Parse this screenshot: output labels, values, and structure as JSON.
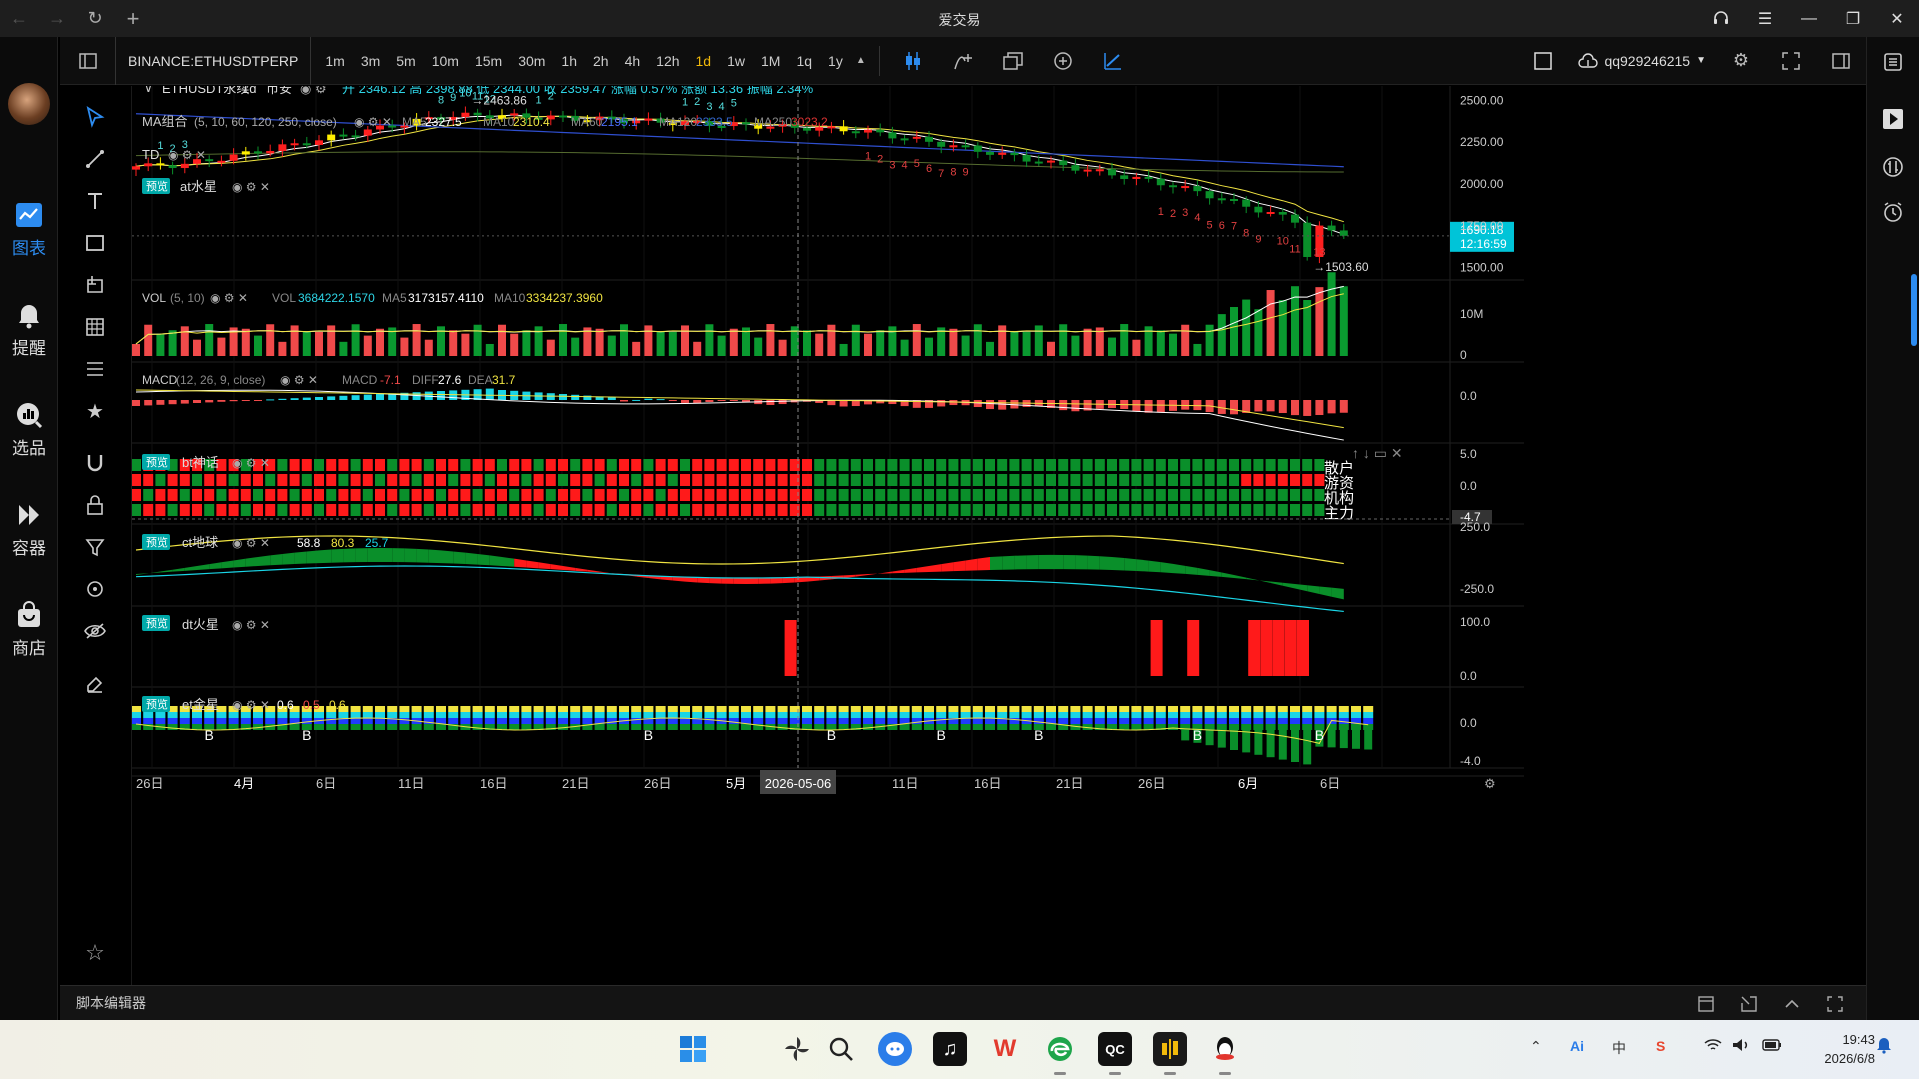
{
  "window": {
    "title": "爱交易"
  },
  "leftnav": {
    "items": [
      {
        "label": "图表",
        "icon": "chart-icon",
        "active": true
      },
      {
        "label": "提醒",
        "icon": "bell-icon",
        "active": false
      },
      {
        "label": "选品",
        "icon": "screener-icon",
        "active": false
      },
      {
        "label": "容器",
        "icon": "container-icon",
        "active": false
      },
      {
        "label": "商店",
        "icon": "store-icon",
        "active": false
      }
    ]
  },
  "toolbar": {
    "symbol": "BINANCE:ETHUSDTPERP",
    "intervals": [
      "1m",
      "3m",
      "5m",
      "10m",
      "15m",
      "30m",
      "1h",
      "2h",
      "4h",
      "12h",
      "1d",
      "1w",
      "1M",
      "1q",
      "1y"
    ],
    "active_interval": "1d",
    "user": "qq929246215"
  },
  "main": {
    "legend_title": "ETHUSDT永续",
    "legend_interval": "1d",
    "legend_exchange": "币安",
    "ohlc": "开 2346.12 高 2398.88 低 2344.00 收 2359.47 涨幅 0.57% 涨额 13.36 振幅 2.34%",
    "ma_label": "MA组合",
    "ma_params": "(5, 10, 60, 120, 250, close)",
    "ma_values": [
      {
        "name": "MA5",
        "value": "2327.5",
        "color": "#ffffff"
      },
      {
        "name": "MA10",
        "value": "2310.4",
        "color": "#f0e442"
      },
      {
        "name": "MA60",
        "value": "2195.1",
        "color": "#4a6cf7"
      },
      {
        "name": "MA120",
        "value": "2333.5",
        "color": "#36c"
      },
      {
        "name": "MA250",
        "value": "3023.2",
        "color": "#d33"
      }
    ],
    "td_label": "TD",
    "at_badge": "预览",
    "at_label": "at水星",
    "price_ticks": [
      "2500.00",
      "2250.00",
      "2000.00",
      "1750.00",
      "1500.00"
    ],
    "current_price": "1690.18",
    "countdown": "12:16:59",
    "high_marker": "→2463.86",
    "low_marker": "→1503.60"
  },
  "vol": {
    "label": "VOL",
    "params": "(5, 10)",
    "vol_name": "VOL",
    "vol_value": "3684222.1570",
    "ma5_name": "MA5",
    "ma5_value": "3173157.4110",
    "ma10_name": "MA10",
    "ma10_value": "3334237.3960",
    "ticks": [
      "10M",
      "0"
    ]
  },
  "macd": {
    "label": "MACD",
    "params": "(12, 26, 9, close)",
    "macd_name": "MACD",
    "macd_value": "-7.1",
    "diff_name": "DIFF",
    "diff_value": "27.6",
    "dea_name": "DEA",
    "dea_value": "31.7",
    "ticks": [
      "0.0"
    ]
  },
  "bt": {
    "badge": "预览",
    "label": "bt神话",
    "ticks": [
      "5.0",
      "0.0",
      "-4.7"
    ],
    "row_labels": [
      "散户",
      "游资",
      "机构",
      "主力"
    ]
  },
  "ct": {
    "badge": "预览",
    "label": "ct地球",
    "values": [
      "58.8",
      "80.3",
      "25.7"
    ],
    "ticks": [
      "250.0",
      "-250.0"
    ]
  },
  "dt": {
    "badge": "预览",
    "label": "dt火星",
    "ticks": [
      "100.0",
      "0.0"
    ]
  },
  "et": {
    "badge": "预览",
    "label": "et金星",
    "values": [
      "0.6",
      "0.5",
      "0.6"
    ],
    "ticks": [
      "0.0",
      "-4.0"
    ],
    "signal": "B"
  },
  "time_axis": {
    "labels": [
      "26日",
      "4月",
      "6日",
      "11日",
      "16日",
      "21日",
      "26日",
      "5月",
      "11日",
      "16日",
      "21日",
      "26日",
      "6月",
      "6日"
    ],
    "crosshair_date": "2026-05-06"
  },
  "script_editor": {
    "title": "脚本编辑器"
  },
  "taskbar": {
    "time": "19:43",
    "date": "2026/6/8",
    "ime": "中"
  },
  "colors": {
    "up": "#ff1f1f",
    "down": "#0a8f2a",
    "accent": "#2d8cf0",
    "highlight": "#f0b90b",
    "price_tag": "#00c4d8"
  },
  "chart_data": {
    "type": "candlestick",
    "symbol": "BINANCE:ETHUSDTPERP",
    "interval": "1d",
    "ylim": [
      1450,
      2550
    ],
    "last": {
      "open": 2346.12,
      "high": 2398.88,
      "low": 2344.0,
      "close": 2359.47
    },
    "annotations": {
      "high": 2463.86,
      "low": 1503.6,
      "current": 1690.18
    }
  }
}
